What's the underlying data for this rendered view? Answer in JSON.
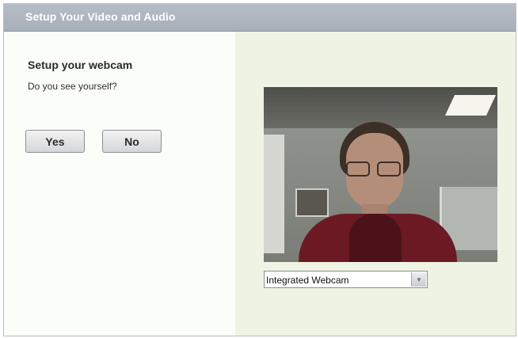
{
  "window": {
    "title": "Setup Your Video and Audio"
  },
  "webcam_step": {
    "heading": "Setup your webcam",
    "question": "Do you see yourself?",
    "yes_label": "Yes",
    "no_label": "No"
  },
  "camera_select": {
    "selected": "Integrated Webcam"
  },
  "icons": {
    "dropdown_arrow": "chevron-down-icon"
  },
  "colors": {
    "titlebar": "#aab1bb",
    "left_pane": "#fbfdf8",
    "right_pane": "#eef3e4"
  }
}
